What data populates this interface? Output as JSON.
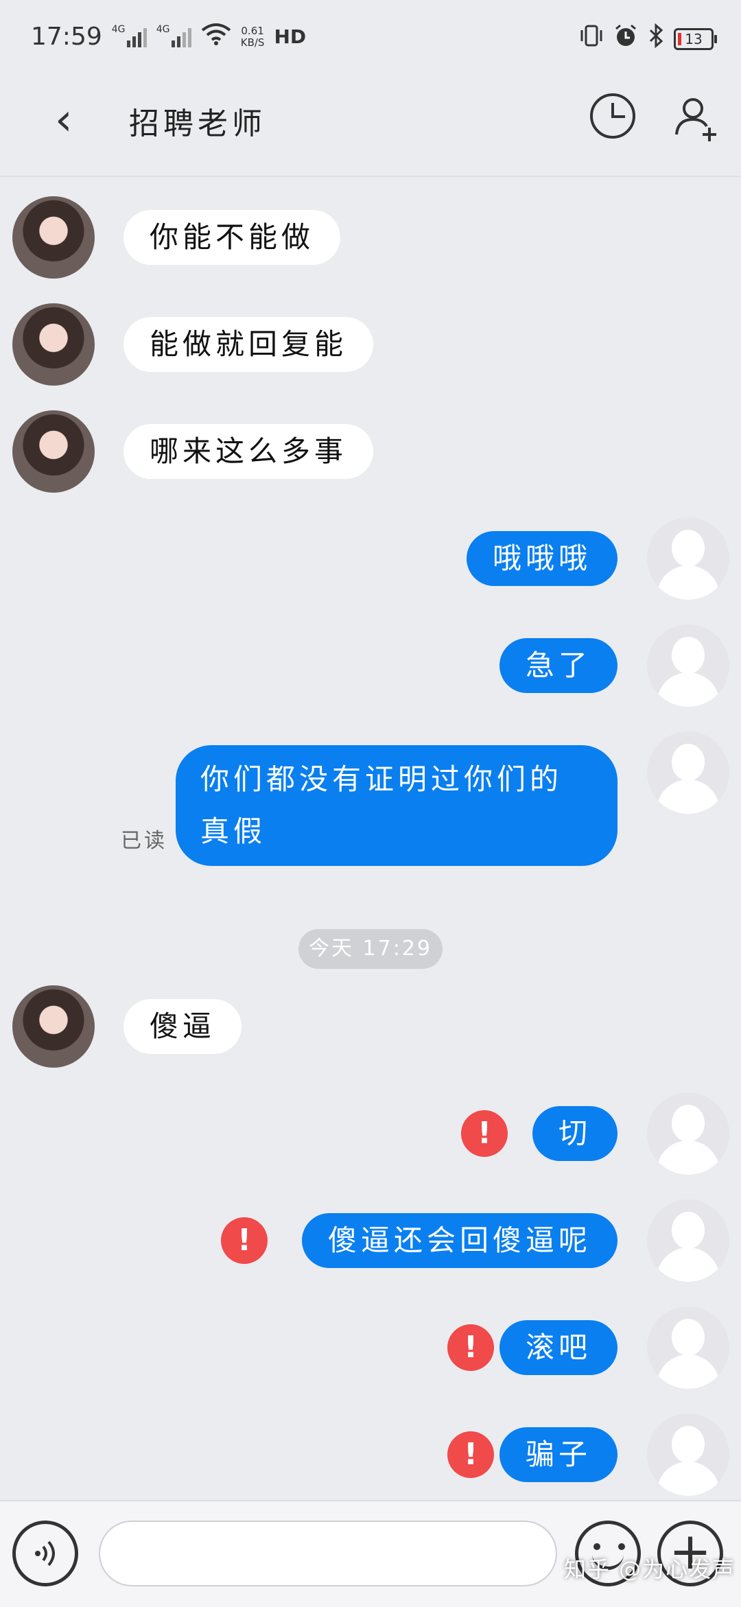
{
  "status_bar": {
    "time": "17:59",
    "signal_1": "4G",
    "signal_2": "4G",
    "net_speed_value": "0.61",
    "net_speed_unit": "KB/S",
    "hd": "HD",
    "battery": "13"
  },
  "header": {
    "back_icon": "‹",
    "title": "招聘老师",
    "history_icon": "clock-icon",
    "add_user_icon": "add-user-icon"
  },
  "messages": [
    {
      "side": "other",
      "text": "你能不能做"
    },
    {
      "side": "other",
      "text": "能做就回复能"
    },
    {
      "side": "other",
      "text": "哪来这么多事"
    },
    {
      "side": "self",
      "text": "哦哦哦"
    },
    {
      "side": "self",
      "text": "急了"
    },
    {
      "side": "self",
      "text": "你们都没有证明过你们的真假",
      "read": "已读"
    },
    {
      "side": "other",
      "text": "傻逼"
    },
    {
      "side": "self",
      "text": "切",
      "failed": true
    },
    {
      "side": "self",
      "text": "傻逼还会回傻逼呢",
      "failed": true
    },
    {
      "side": "self",
      "text": "滚吧",
      "failed": true
    },
    {
      "side": "self",
      "text": "骗子",
      "failed": true
    }
  ],
  "time_separator": "今天 17:29",
  "error_mark": "!",
  "input_bar": {
    "voice_icon": "voice-icon",
    "input_value": "",
    "emoji_icon": "emoji-icon",
    "plus_icon": "+"
  },
  "watermark": "知乎 @为心发声",
  "colors": {
    "self_bubble": "#0a7ff0",
    "other_bubble": "#ffffff",
    "error": "#f04a4a",
    "background": "#ebecf0"
  }
}
